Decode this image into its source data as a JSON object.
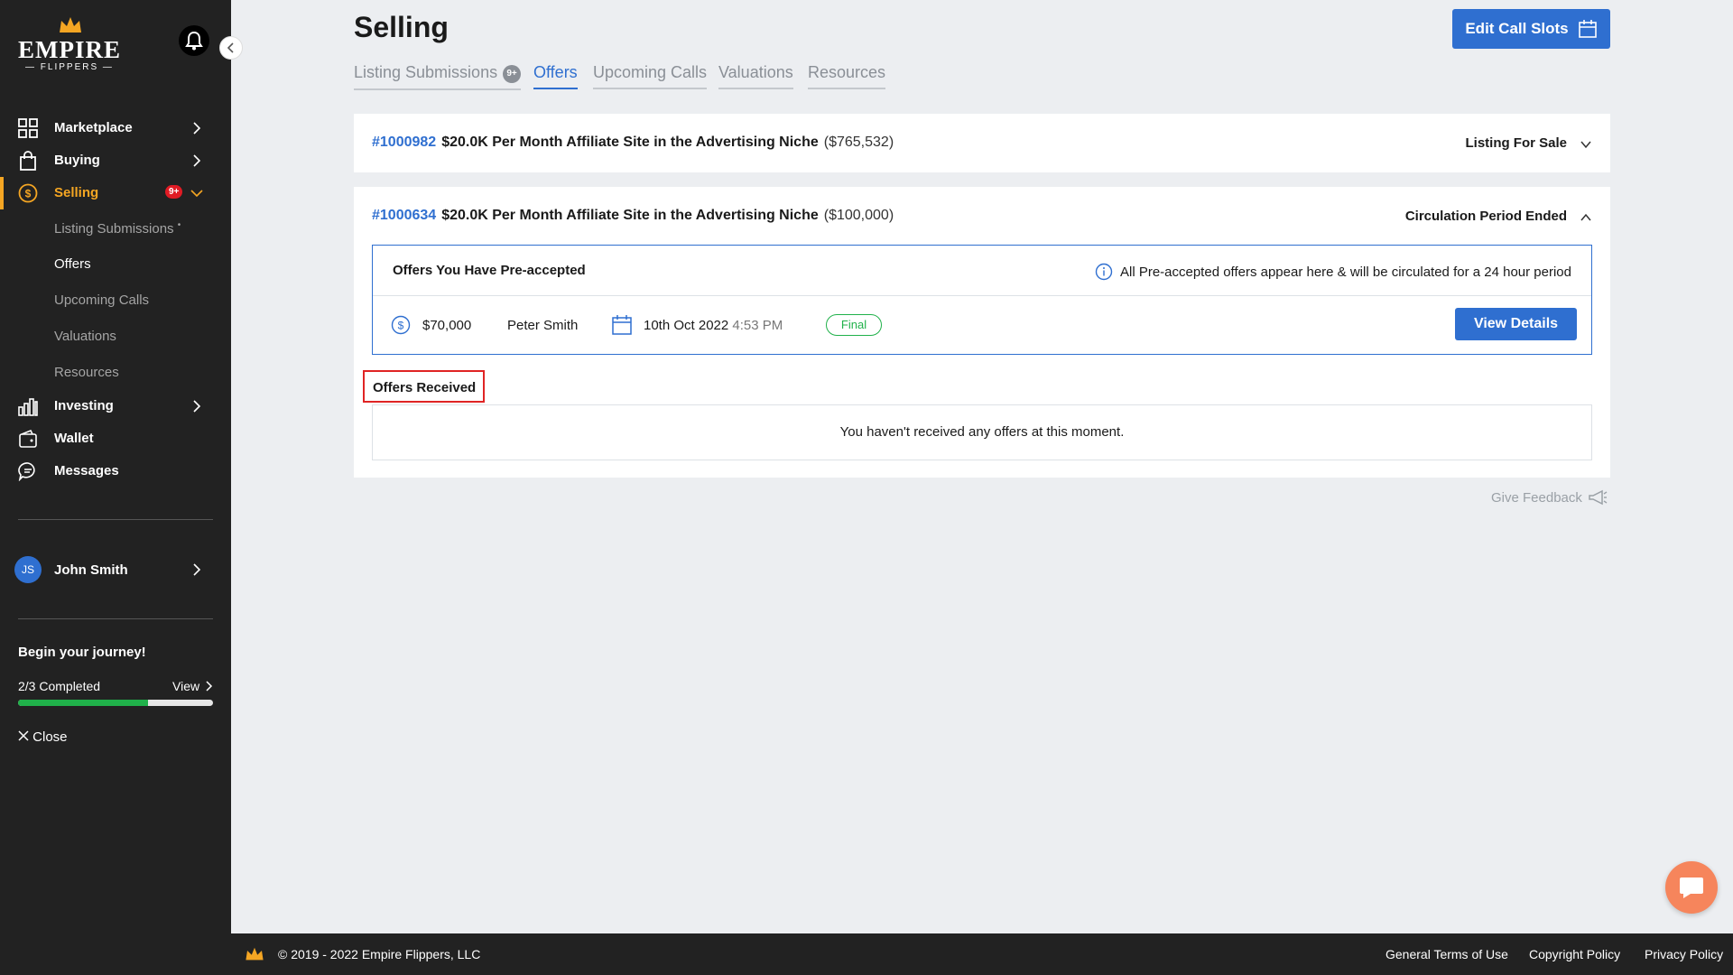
{
  "brand": {
    "name": "EMPIRE",
    "sub": "— FLIPPERS —",
    "accent": "#f5a623",
    "primary": "#2f6fd0"
  },
  "sidebar": {
    "items": [
      {
        "label": "Marketplace",
        "icon": "grid-icon"
      },
      {
        "label": "Buying",
        "icon": "shopping-bag-icon"
      },
      {
        "label": "Selling",
        "icon": "dollar-circle-icon",
        "badge": "9+"
      },
      {
        "label": "Investing",
        "icon": "bar-chart-icon"
      },
      {
        "label": "Wallet",
        "icon": "wallet-icon"
      },
      {
        "label": "Messages",
        "icon": "chat-bubble-icon"
      }
    ],
    "selling_sub": [
      {
        "label": "Listing Submissions",
        "dot": "•"
      },
      {
        "label": "Offers"
      },
      {
        "label": "Upcoming Calls"
      },
      {
        "label": "Valuations"
      },
      {
        "label": "Resources"
      }
    ],
    "user": {
      "initials": "JS",
      "name": "John Smith"
    },
    "journey": {
      "title": "Begin your journey!",
      "progress_text": "2/3 Completed",
      "progress": 0.667,
      "view_label": "View",
      "close_label": "Close"
    }
  },
  "header": {
    "title": "Selling",
    "edit_button": "Edit Call Slots"
  },
  "tabs": [
    {
      "label": "Listing Submissions",
      "badge": "9+"
    },
    {
      "label": "Offers",
      "active": true
    },
    {
      "label": "Upcoming Calls"
    },
    {
      "label": "Valuations"
    },
    {
      "label": "Resources"
    }
  ],
  "listings": [
    {
      "id": "#1000982",
      "title": "$20.0K Per Month Affiliate Site in the Advertising Niche",
      "price": "($765,532)",
      "status": "Listing For Sale"
    },
    {
      "id": "#1000634",
      "title": "$20.0K Per Month Affiliate Site in the Advertising Niche",
      "price": "($100,000)",
      "status": "Circulation Period Ended"
    }
  ],
  "preaccepted": {
    "title": "Offers You Have Pre-accepted",
    "note": "All Pre-accepted offers appear here & will be circulated for a 24 hour period",
    "offer": {
      "amount": "$70,000",
      "buyer": "Peter Smith",
      "date": "10th Oct 2022",
      "time": "4:53 PM",
      "status": "Final",
      "button": "View Details"
    }
  },
  "received": {
    "title": "Offers Received",
    "empty": "You haven't received any offers at this moment."
  },
  "feedback": "Give Feedback",
  "footer": {
    "copyright": "© 2019 - 2022 Empire Flippers, LLC",
    "links": [
      "General Terms of Use",
      "Copyright Policy",
      "Privacy Policy"
    ]
  }
}
